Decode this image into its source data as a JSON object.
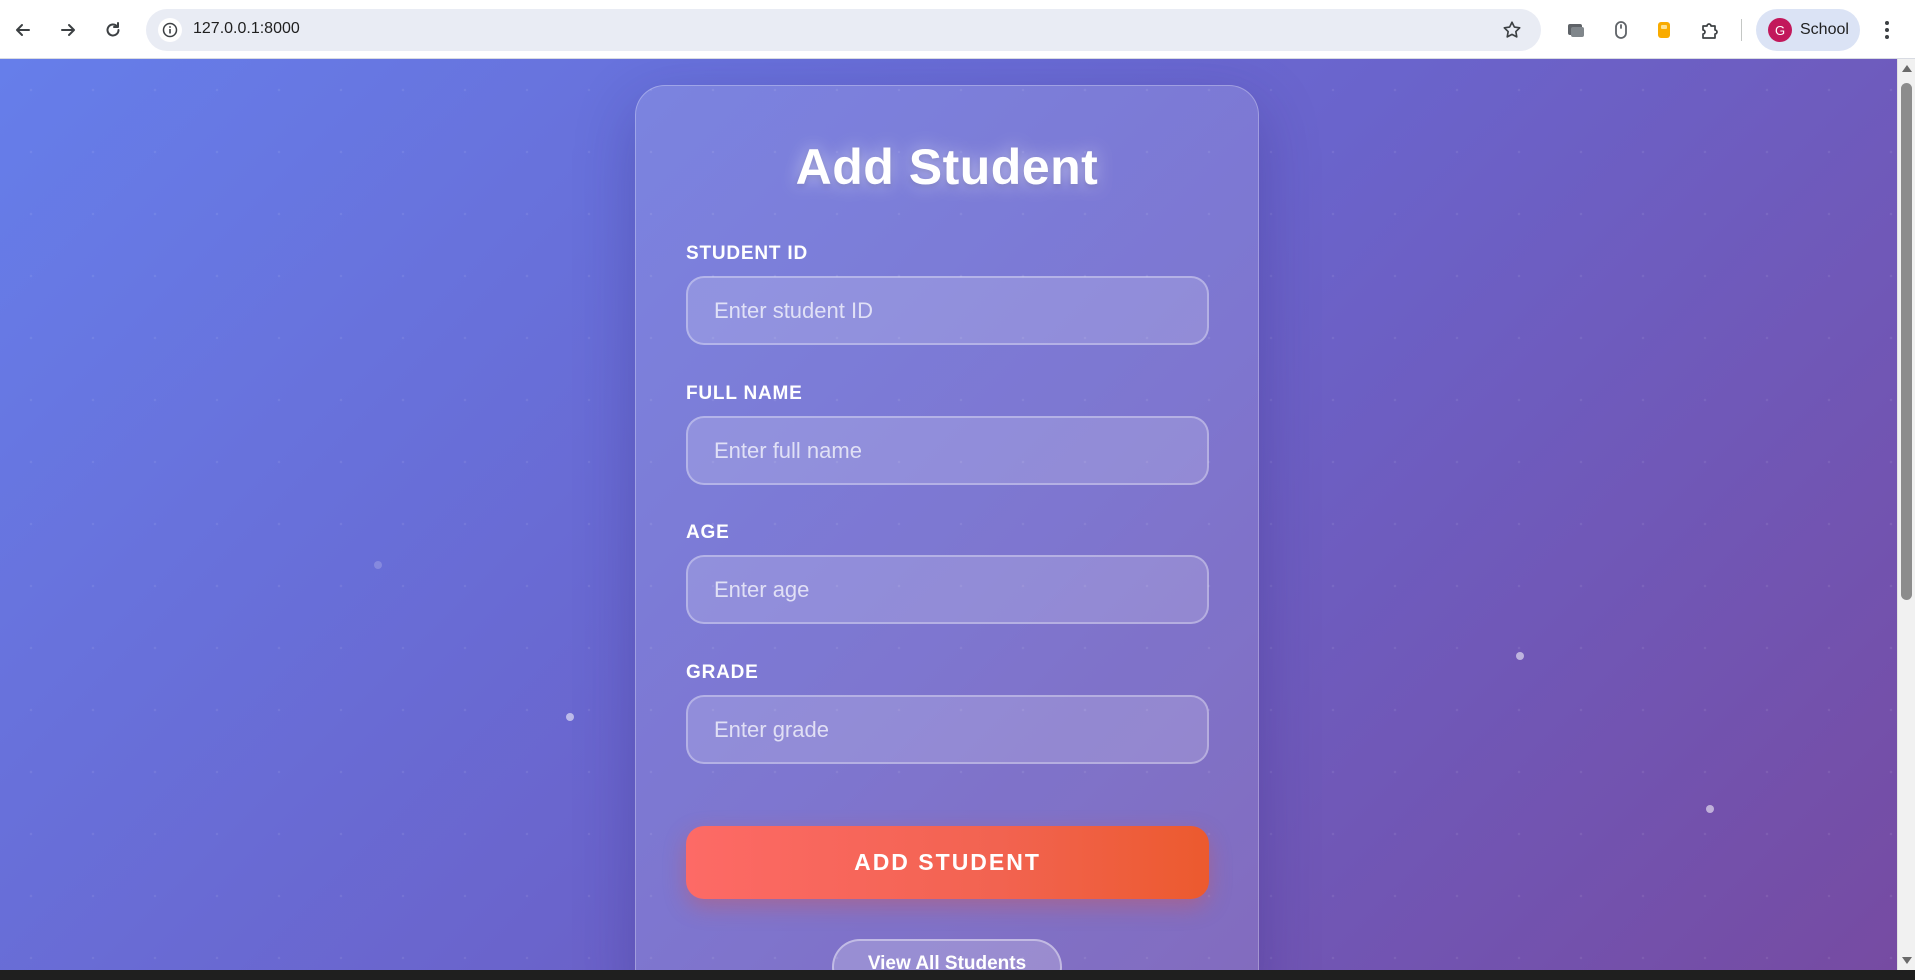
{
  "browser": {
    "url": "127.0.0.1:8000",
    "profile_initial": "G",
    "profile_name": "School",
    "icons": {
      "back": "arrow-left-icon",
      "forward": "arrow-right-icon",
      "reload": "reload-icon",
      "site_info": "info-icon",
      "bookmark": "star-icon",
      "extensions": [
        "media-extension-icon",
        "mouse-extension-icon",
        "yellow-extension-icon",
        "puzzle-extension-icon"
      ],
      "menu": "more-vertical-icon"
    }
  },
  "form": {
    "title": "Add Student",
    "fields": [
      {
        "label": "STUDENT ID",
        "placeholder": "Enter student ID"
      },
      {
        "label": "FULL NAME",
        "placeholder": "Enter full name"
      },
      {
        "label": "AGE",
        "placeholder": "Enter age"
      },
      {
        "label": "GRADE",
        "placeholder": "Enter grade"
      }
    ],
    "submit_label": "ADD STUDENT",
    "view_all_label": "View All Students"
  },
  "colors": {
    "background_start": "#667eea",
    "background_end": "#764ba2",
    "submit_start": "#fd6a66",
    "submit_end": "#ec5a2e",
    "avatar": "#c2185b"
  }
}
